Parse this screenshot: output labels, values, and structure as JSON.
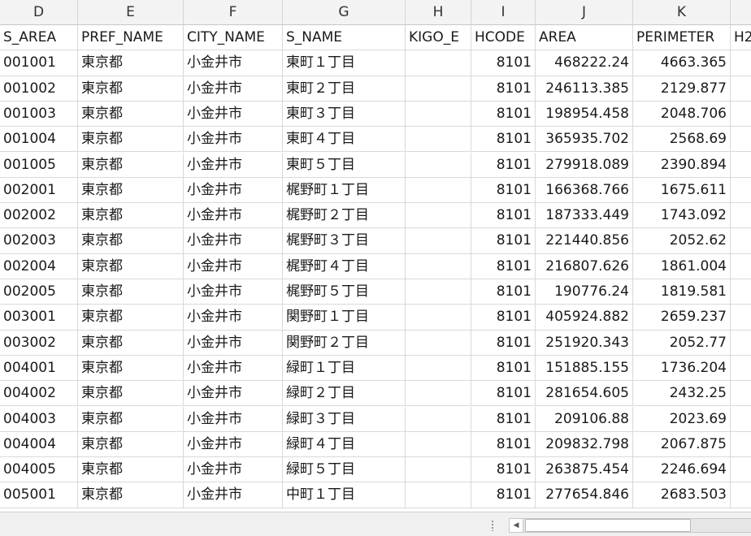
{
  "columns": [
    {
      "letter": "D",
      "header": "S_AREA",
      "align": "txt"
    },
    {
      "letter": "E",
      "header": "PREF_NAME",
      "align": "txt"
    },
    {
      "letter": "F",
      "header": "CITY_NAME",
      "align": "txt"
    },
    {
      "letter": "G",
      "header": "S_NAME",
      "align": "txt"
    },
    {
      "letter": "H",
      "header": "KIGO_E",
      "align": "txt"
    },
    {
      "letter": "I",
      "header": "HCODE",
      "align": "txt"
    },
    {
      "letter": "J",
      "header": "AREA",
      "align": "txt"
    },
    {
      "letter": "K",
      "header": "PERIMETER",
      "align": "txt"
    },
    {
      "letter": "",
      "header": "H2",
      "align": "txt"
    }
  ],
  "rows": [
    [
      "001001",
      "東京都",
      "小金井市",
      "東町１丁目",
      "",
      "8101",
      "468222.24",
      "4663.365",
      ""
    ],
    [
      "001002",
      "東京都",
      "小金井市",
      "東町２丁目",
      "",
      "8101",
      "246113.385",
      "2129.877",
      ""
    ],
    [
      "001003",
      "東京都",
      "小金井市",
      "東町３丁目",
      "",
      "8101",
      "198954.458",
      "2048.706",
      ""
    ],
    [
      "001004",
      "東京都",
      "小金井市",
      "東町４丁目",
      "",
      "8101",
      "365935.702",
      "2568.69",
      ""
    ],
    [
      "001005",
      "東京都",
      "小金井市",
      "東町５丁目",
      "",
      "8101",
      "279918.089",
      "2390.894",
      ""
    ],
    [
      "002001",
      "東京都",
      "小金井市",
      "梶野町１丁目",
      "",
      "8101",
      "166368.766",
      "1675.611",
      ""
    ],
    [
      "002002",
      "東京都",
      "小金井市",
      "梶野町２丁目",
      "",
      "8101",
      "187333.449",
      "1743.092",
      ""
    ],
    [
      "002003",
      "東京都",
      "小金井市",
      "梶野町３丁目",
      "",
      "8101",
      "221440.856",
      "2052.62",
      ""
    ],
    [
      "002004",
      "東京都",
      "小金井市",
      "梶野町４丁目",
      "",
      "8101",
      "216807.626",
      "1861.004",
      ""
    ],
    [
      "002005",
      "東京都",
      "小金井市",
      "梶野町５丁目",
      "",
      "8101",
      "190776.24",
      "1819.581",
      ""
    ],
    [
      "003001",
      "東京都",
      "小金井市",
      "関野町１丁目",
      "",
      "8101",
      "405924.882",
      "2659.237",
      ""
    ],
    [
      "003002",
      "東京都",
      "小金井市",
      "関野町２丁目",
      "",
      "8101",
      "251920.343",
      "2052.77",
      ""
    ],
    [
      "004001",
      "東京都",
      "小金井市",
      "緑町１丁目",
      "",
      "8101",
      "151885.155",
      "1736.204",
      ""
    ],
    [
      "004002",
      "東京都",
      "小金井市",
      "緑町２丁目",
      "",
      "8101",
      "281654.605",
      "2432.25",
      ""
    ],
    [
      "004003",
      "東京都",
      "小金井市",
      "緑町３丁目",
      "",
      "8101",
      "209106.88",
      "2023.69",
      ""
    ],
    [
      "004004",
      "東京都",
      "小金井市",
      "緑町４丁目",
      "",
      "8101",
      "209832.798",
      "2067.875",
      ""
    ],
    [
      "004005",
      "東京都",
      "小金井市",
      "緑町５丁目",
      "",
      "8101",
      "263875.454",
      "2246.694",
      ""
    ],
    [
      "005001",
      "東京都",
      "小金井市",
      "中町１丁目",
      "",
      "8101",
      "277654.846",
      "2683.503",
      ""
    ]
  ],
  "cell_alignment": [
    "txt",
    "txt",
    "txt",
    "txt",
    "txt",
    "num",
    "num",
    "num",
    "txt"
  ],
  "colors": {
    "header_bg": "#f3f3f3",
    "grid_line": "#d9d9d9",
    "text": "#1a1a1a"
  },
  "icons": {
    "scroll_left": "triangle-left-icon",
    "grip": "sheet-tab-splitter-icon"
  }
}
